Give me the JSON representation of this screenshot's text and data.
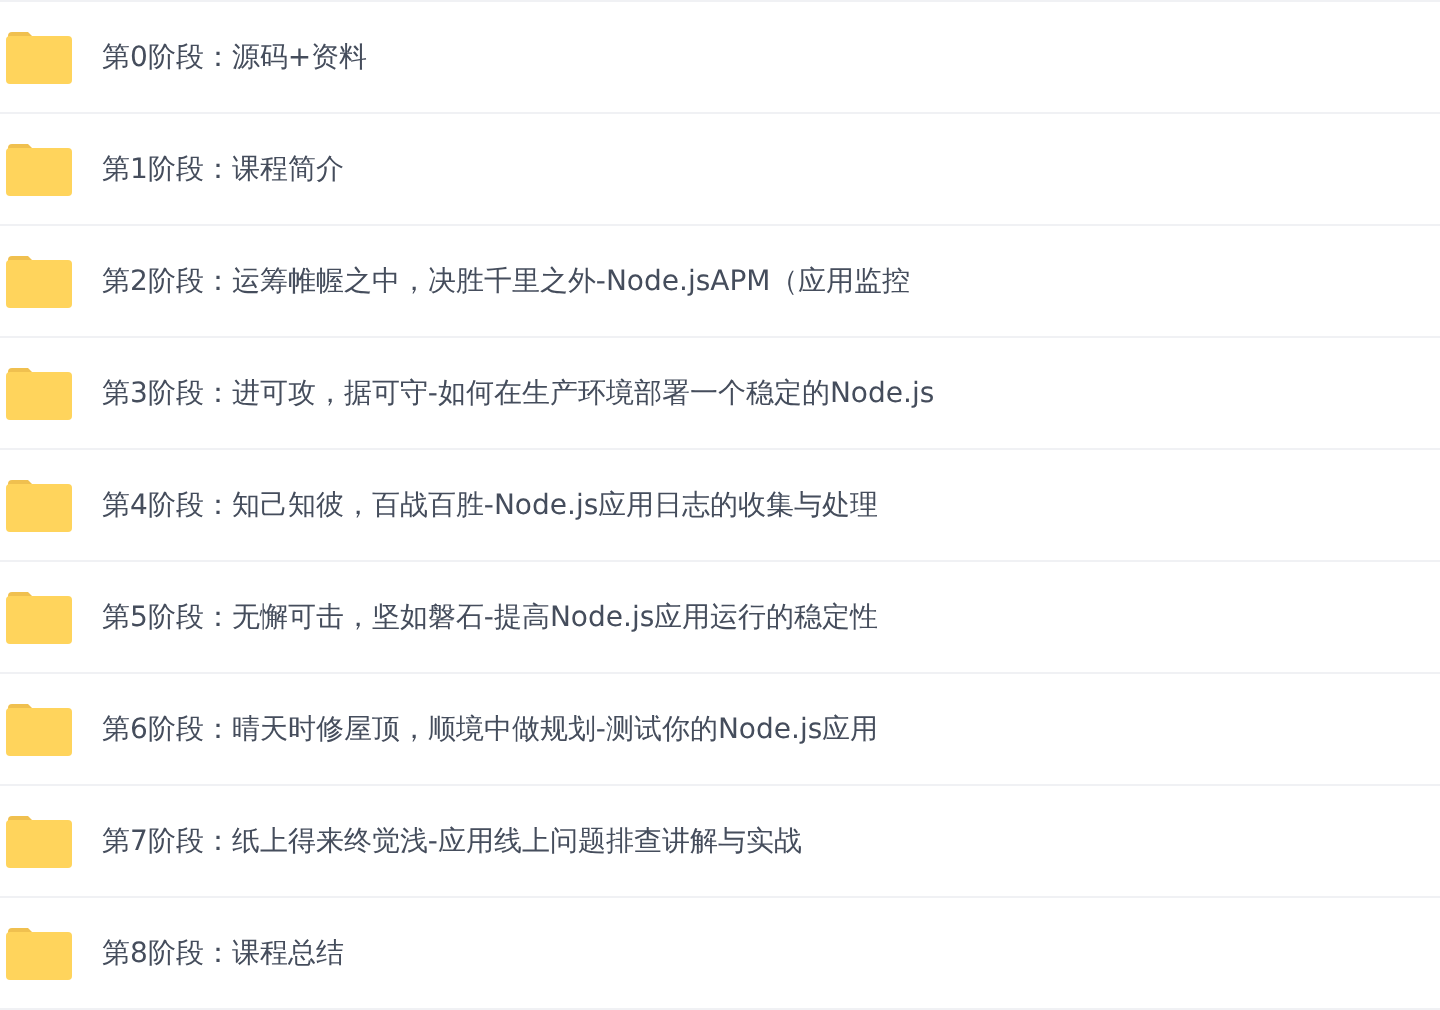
{
  "folders": [
    {
      "name": "第0阶段：源码+资料"
    },
    {
      "name": "第1阶段：课程简介"
    },
    {
      "name": "第2阶段：运筹帷幄之中，决胜千里之外-Node.jsAPM（应用监控"
    },
    {
      "name": "第3阶段：进可攻，据可守-如何在生产环境部署一个稳定的Node.js"
    },
    {
      "name": "第4阶段：知己知彼，百战百胜-Node.js应用日志的收集与处理"
    },
    {
      "name": "第5阶段：无懈可击，坚如磐石-提高Node.js应用运行的稳定性"
    },
    {
      "name": "第6阶段：晴天时修屋顶，顺境中做规划-测试你的Node.js应用"
    },
    {
      "name": "第7阶段：纸上得来终觉浅-应用线上问题排查讲解与实战"
    },
    {
      "name": "第8阶段：课程总结"
    }
  ]
}
